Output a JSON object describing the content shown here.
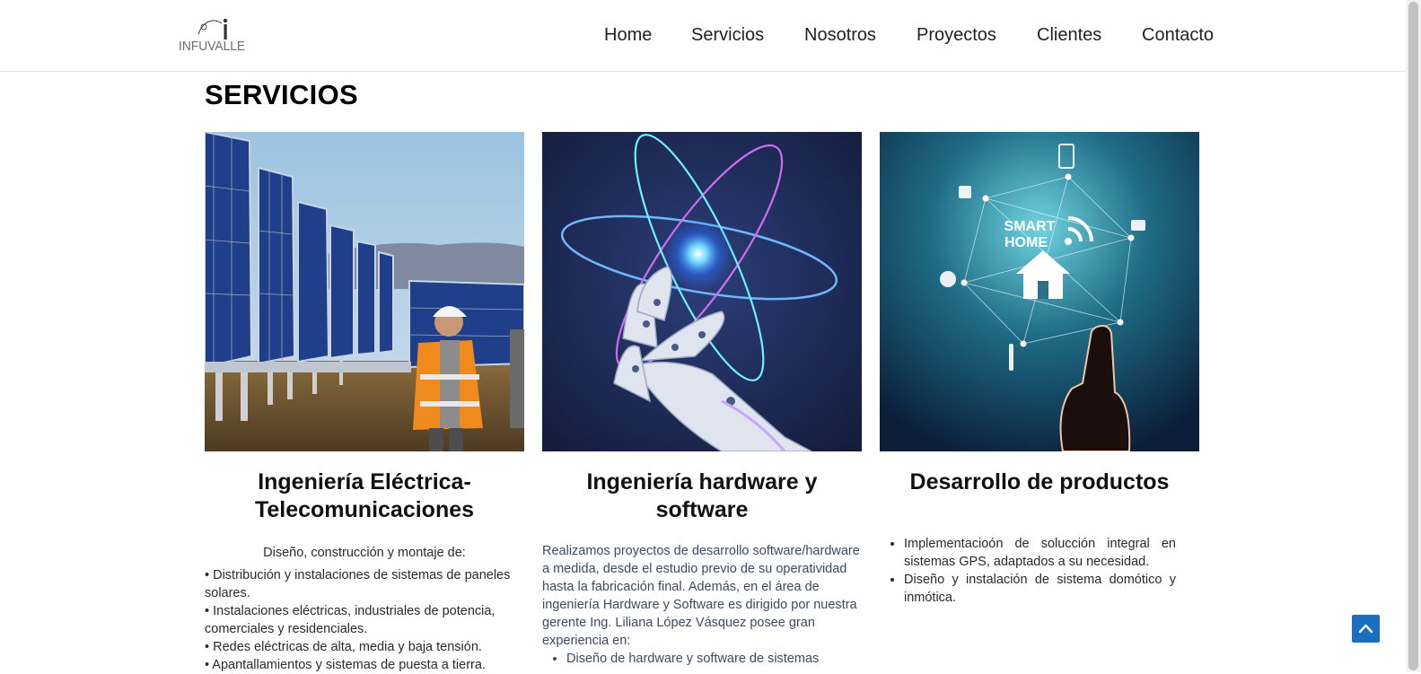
{
  "header": {
    "logo_text": "INFUVALLE",
    "nav": [
      "Home",
      "Servicios",
      "Nosotros",
      "Proyectos",
      "Clientes",
      "Contacto"
    ]
  },
  "section": {
    "title": "SERVICIOS"
  },
  "cards": [
    {
      "image": "solar-panels-worker-photo",
      "title_line1": "Ingeniería Eléctrica-",
      "title_line2": "Telecomunicaciones",
      "lead": "Diseño, construcción y montaje de:",
      "items": [
        "• Distribución y instalaciones de sistemas de paneles solares.",
        "• Instalaciones eléctricas, industriales de potencia, comerciales y residenciales.",
        "• Redes eléctricas de alta, media y baja tensión.",
        "• Apantallamientos y sistemas de puesta a tierra."
      ]
    },
    {
      "image": "robot-hand-atom-photo",
      "title_line1": "Ingeniería hardware y",
      "title_line2": "software",
      "text": "Realizamos proyectos de desarrollo software/hardware a medida, desde el estudio previo de su operatividad hasta la fabricación final. Además, en el área  de ingeniería Hardware y Software  es  dirigido  por  nuestra gerente  Ing. Liliana López Vásquez  posee gran experiencia en:",
      "items": [
        "Diseño de hardware y software de sistemas"
      ]
    },
    {
      "image": "smart-home-hand-photo",
      "title_line1": "Desarrollo de productos",
      "image_text_line1": "SMART",
      "image_text_line2": "HOME",
      "items": [
        "Implementacioón  de solucción integral  en sistemas  GPS,  adaptados  a   su  necesidad.",
        "Diseño  y  instalación de sistema domótico  y inmótica."
      ]
    }
  ],
  "colors": {
    "accent": "#1b6fbf",
    "text_blue": "#3d4a63"
  },
  "icons": {
    "back_to_top": "chevron-up-icon"
  }
}
